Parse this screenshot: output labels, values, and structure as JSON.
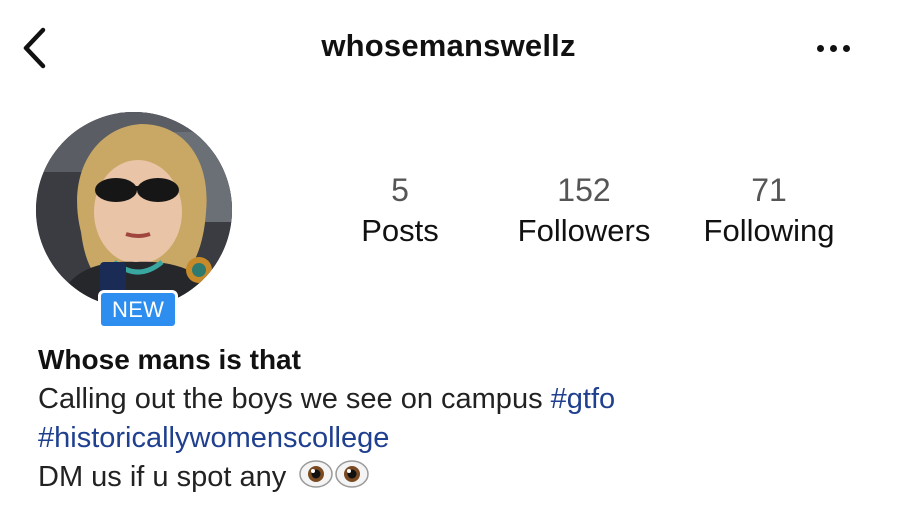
{
  "header": {
    "username": "whosemanswellz",
    "back_icon": "chevron-left-icon",
    "more_icon": "more-horizontal-icon"
  },
  "profile": {
    "avatar_icon": "profile-photo",
    "new_badge": "NEW"
  },
  "stats": [
    {
      "count": "5",
      "label": "Posts"
    },
    {
      "count": "152",
      "label": "Followers"
    },
    {
      "count": "71",
      "label": "Following"
    }
  ],
  "bio": {
    "display_name": "Whose mans is that",
    "line1_text": "Calling out the boys we see on campus ",
    "hashtag1": "#gtfo",
    "hashtag2": "#historicallywomenscollege",
    "line3_text": "DM us if u spot any",
    "emoji_icons": [
      "eyes-emoji-icon",
      "eyes-emoji-icon"
    ]
  },
  "colors": {
    "badge": "#2d8ef0",
    "hashtag": "#1f3f8f",
    "count_gray": "#555555"
  }
}
